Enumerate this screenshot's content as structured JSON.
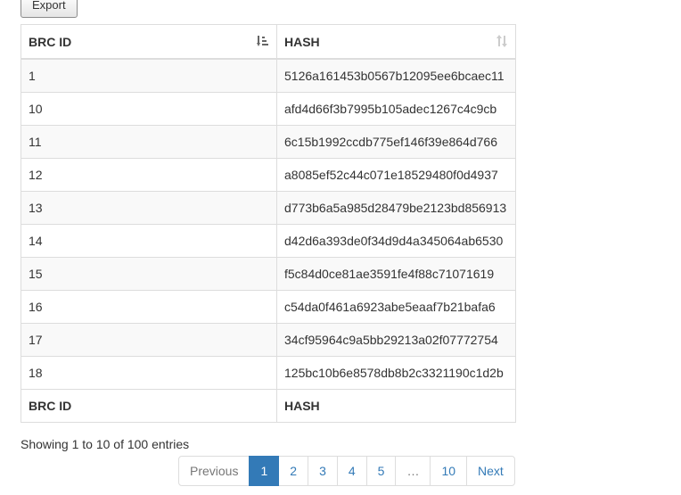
{
  "toolbar": {
    "export_label": "Export"
  },
  "table": {
    "columns": [
      "BRC ID",
      "HASH"
    ],
    "footer_columns": [
      "BRC ID",
      "HASH"
    ],
    "sort": {
      "brc_id": "ascending",
      "hash": "unsorted"
    },
    "rows": [
      {
        "id": "1",
        "hash": "5126a161453b0567b12095ee6bcaec11"
      },
      {
        "id": "10",
        "hash": "afd4d66f3b7995b105adec1267c4c9cb"
      },
      {
        "id": "11",
        "hash": "6c15b1992ccdb775ef146f39e864d766"
      },
      {
        "id": "12",
        "hash": "a8085ef52c44c071e18529480f0d4937"
      },
      {
        "id": "13",
        "hash": "d773b6a5a985d28479be2123bd856913"
      },
      {
        "id": "14",
        "hash": "d42d6a393de0f34d9d4a345064ab6530"
      },
      {
        "id": "15",
        "hash": "f5c84d0ce81ae3591fe4f88c71071619"
      },
      {
        "id": "16",
        "hash": "c54da0f461a6923abe5eaaf7b21bafa6"
      },
      {
        "id": "17",
        "hash": "34cf95964c9a5bb29213a02f07772754"
      },
      {
        "id": "18",
        "hash": "125bc10b6e8578db8b2c3321190c1d2b"
      }
    ]
  },
  "info": {
    "text": "Showing 1 to 10 of 100 entries"
  },
  "pagination": {
    "previous": "Previous",
    "pages": [
      "1",
      "2",
      "3",
      "4",
      "5",
      "…",
      "10"
    ],
    "next": "Next",
    "current": "1"
  },
  "colors": {
    "accent": "#337ab7",
    "stripe": "#f9f9f9",
    "border": "#dddddd"
  }
}
